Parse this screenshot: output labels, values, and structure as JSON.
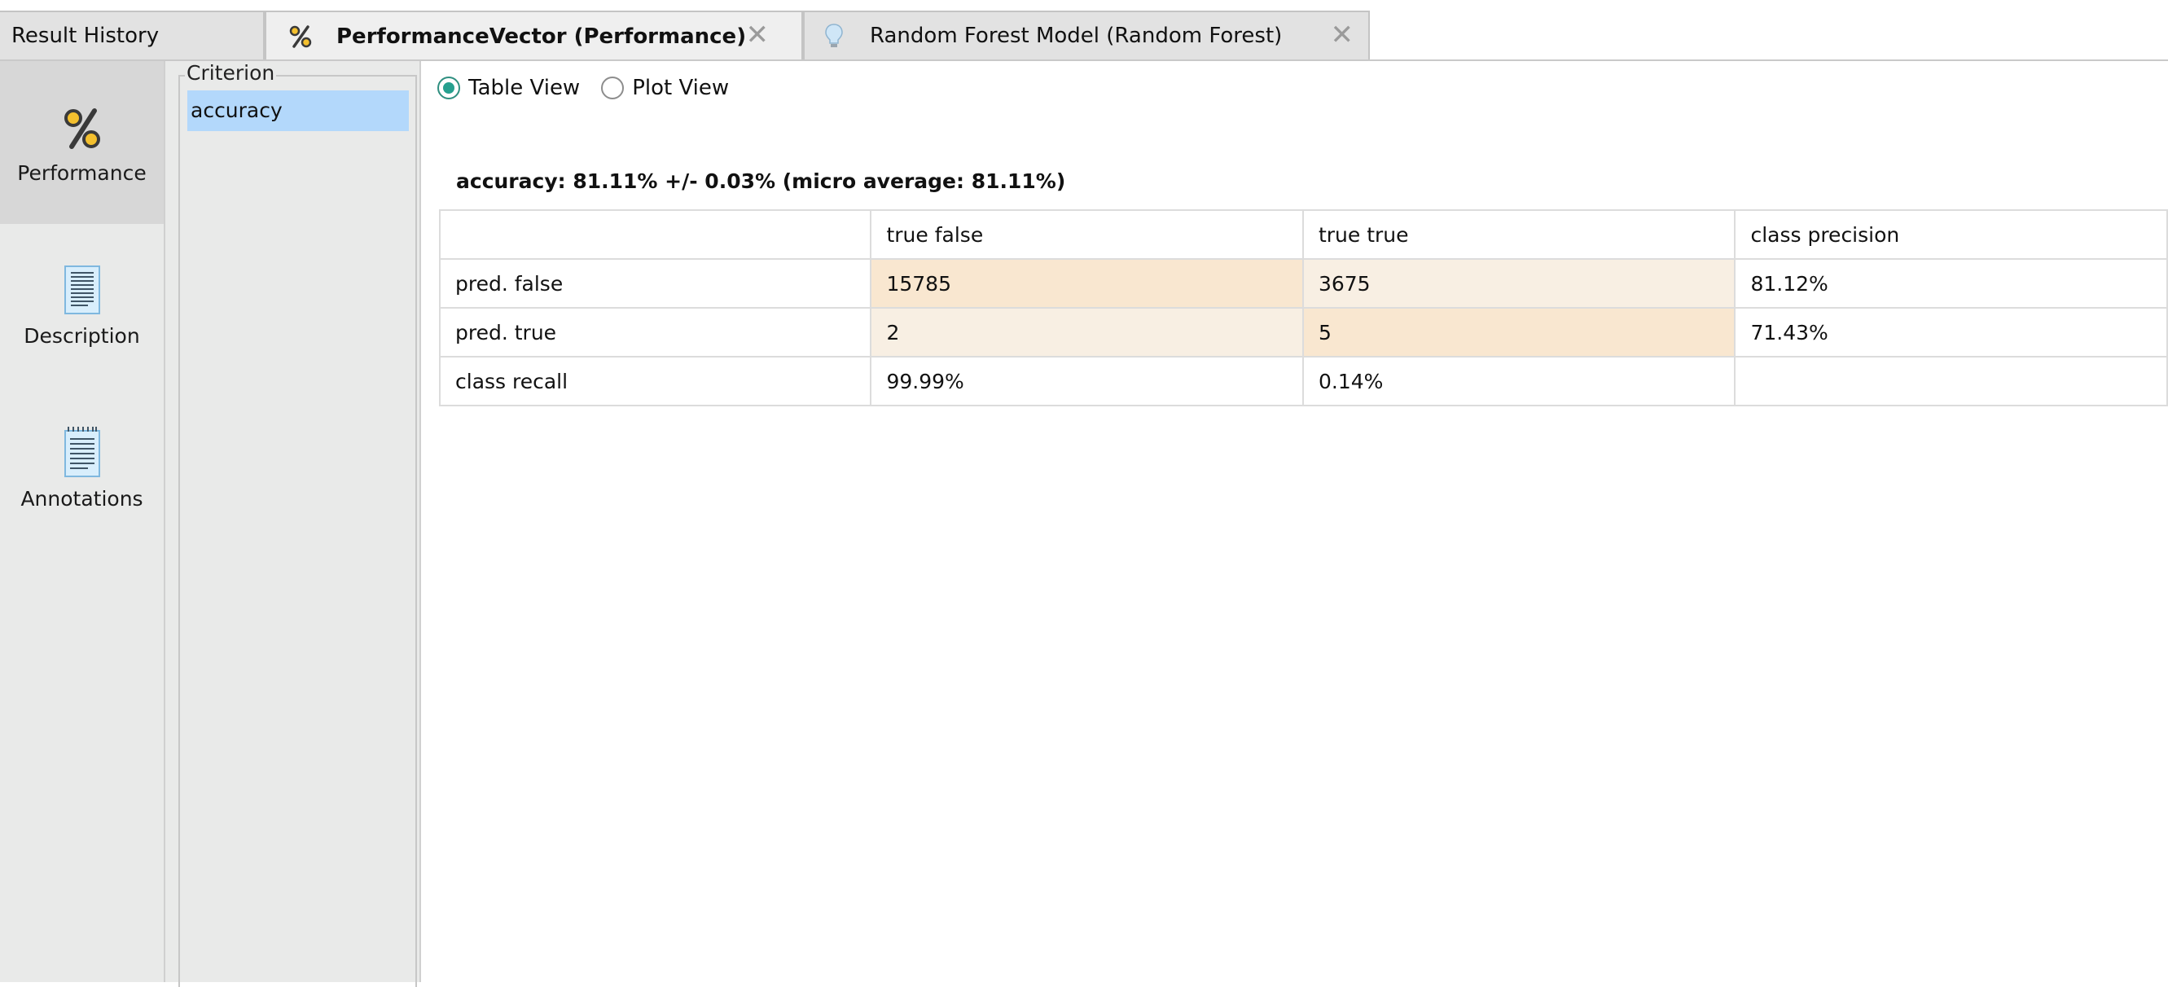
{
  "tabs": [
    {
      "label": "Result History"
    },
    {
      "label": "PerformanceVector (Performance)",
      "icon": "percent-icon",
      "close": "✕"
    },
    {
      "label": "Random Forest Model (Random Forest)",
      "icon": "lightbulb-icon",
      "close": "✕"
    }
  ],
  "leftnav": {
    "items": [
      {
        "label": "Performance",
        "icon": "percent-icon",
        "selected": true
      },
      {
        "label": "Description",
        "icon": "document-icon"
      },
      {
        "label": "Annotations",
        "icon": "notepad-icon"
      }
    ]
  },
  "criterion": {
    "legend": "Criterion",
    "items": [
      "accuracy"
    ],
    "selected": "accuracy"
  },
  "view_toggle": {
    "options": [
      "Table View",
      "Plot View"
    ],
    "selected": "Table View"
  },
  "result": {
    "title": "accuracy: 81.11% +/- 0.03% (micro average: 81.11%)",
    "headers": [
      "",
      "true false",
      "true true",
      "class precision"
    ],
    "rows": [
      [
        "pred. false",
        "15785",
        "3675",
        "81.12%"
      ],
      [
        "pred. true",
        "2",
        "5",
        "71.43%"
      ],
      [
        "class recall",
        "99.99%",
        "0.14%",
        ""
      ]
    ]
  },
  "colors": {
    "selection": "#b3d8fb",
    "radio_accent": "#26a08f",
    "cell_highlight": "#f9e7d0",
    "cell_light": "#f8efe3"
  }
}
